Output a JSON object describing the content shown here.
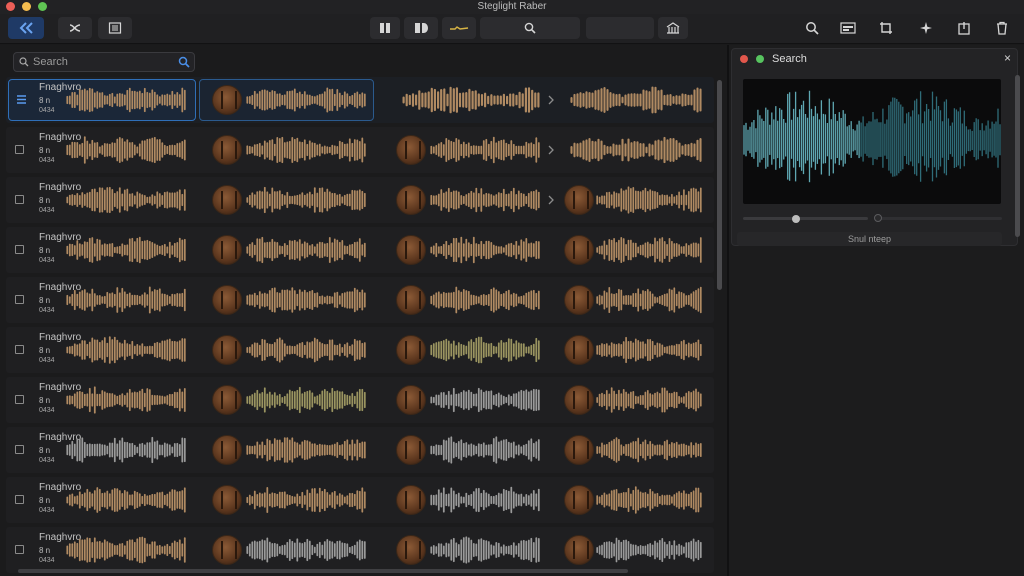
{
  "window": {
    "title": "Steglight Raber"
  },
  "toolbar": {
    "left_buttons": [
      "back-double-chevron-icon",
      "shuffle-icon",
      "list-icon"
    ],
    "center_buttons": [
      "columns-icon",
      "split-view-icon",
      "waveform-indicator-icon",
      "search-icon",
      "library-icon"
    ],
    "right_buttons": [
      "search-icon",
      "inspector-icon",
      "crop-icon",
      "sparkle-icon",
      "export-icon",
      "trash-icon"
    ]
  },
  "search": {
    "placeholder": "Search",
    "value": ""
  },
  "rows": [
    {
      "label": "Fnaghvro",
      "sub": "8 n",
      "code": "0434"
    },
    {
      "label": "Fnaghvro",
      "sub": "8 n",
      "code": "0434"
    },
    {
      "label": "Fnaghvro",
      "sub": "8 n",
      "code": "0434"
    },
    {
      "label": "Fnaghvro",
      "sub": "8 n",
      "code": "0434"
    },
    {
      "label": "Fnaghvro",
      "sub": "8 n",
      "code": "0434"
    },
    {
      "label": "Fnaghvro",
      "sub": "8 n",
      "code": "0434"
    },
    {
      "label": "Fnaghvro",
      "sub": "8 n",
      "code": "0434"
    },
    {
      "label": "Fnaghvro",
      "sub": "8 n",
      "code": "0434"
    },
    {
      "label": "Fnaghvro",
      "sub": "8 n",
      "code": "0434"
    },
    {
      "label": "Fnaghvro",
      "sub": "8 n",
      "code": "0434"
    }
  ],
  "preview": {
    "title": "Search",
    "close_label": "×",
    "footer": "Snul nteep"
  },
  "colors": {
    "accent": "#2f6fb8",
    "waveform_tan": "#b08a62",
    "waveform_teal": "#5fa7b2",
    "waveform_olive": "#9a9460",
    "waveform_gray": "#9a9a9a"
  }
}
